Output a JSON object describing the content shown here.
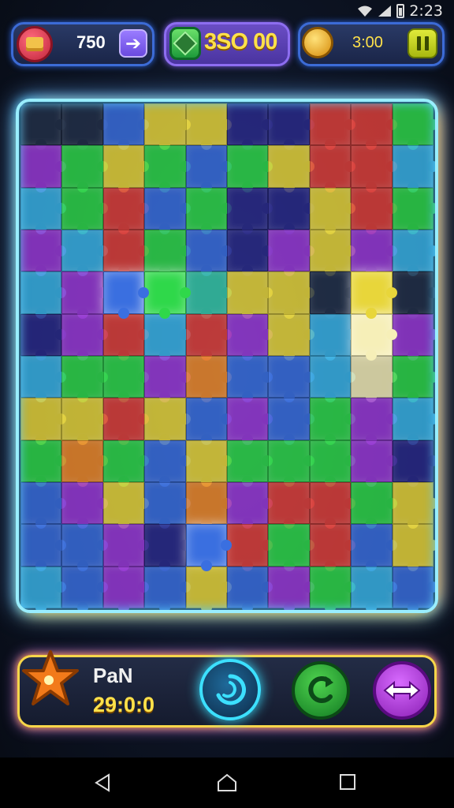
{
  "status_bar": {
    "time": "2:23",
    "icons": [
      "wifi-icon",
      "signal-icon",
      "battery-icon"
    ]
  },
  "hud": {
    "lives_value": "750",
    "gems_value": "3SO 00",
    "coins_value": "3:00",
    "icons": {
      "left": "gift-icon",
      "center": "gem-icon",
      "right": "coin-icon",
      "arrow": "arrow-right-icon",
      "pause": "pause-icon"
    }
  },
  "board": {
    "columns": 10,
    "rows": 12,
    "palette": {
      "g": "#2fd84a",
      "y": "#e8d63a",
      "b": "#3a6fe0",
      "p": "#9a3ad8",
      "r": "#e0403a",
      "o": "#f08a2a",
      "c": "#3ab4e8",
      "d": "#2a2a8a",
      "t": "#36c8a8",
      "w": "#f6efb8",
      "k": "#233048"
    },
    "tiles": [
      "kkbyyddrrg",
      "pgygbgyrrc",
      "cgrbgddyrg",
      "pcrgbdpypc",
      "cpbgtyyky",
      "dprcrpycwp",
      "cggpobbcwg",
      "yyrybpbgpc",
      "gogbygggpd",
      "bpyboprrgy",
      "bbpdbrgrby",
      "cbpbybpgcb"
    ],
    "glow_tiles": [
      "4-2",
      "4-3",
      "4-8",
      "5-8",
      "10-4"
    ]
  },
  "bottom_panel": {
    "label": "PaN",
    "score": "29:0:0",
    "icons": {
      "badge": "star-icon",
      "rotate": "rotate-icon",
      "shuffle": "shuffle-icon",
      "swap": "swap-arrows-icon"
    }
  },
  "nav": {
    "icons": [
      "back-icon",
      "home-icon",
      "recents-icon"
    ]
  }
}
